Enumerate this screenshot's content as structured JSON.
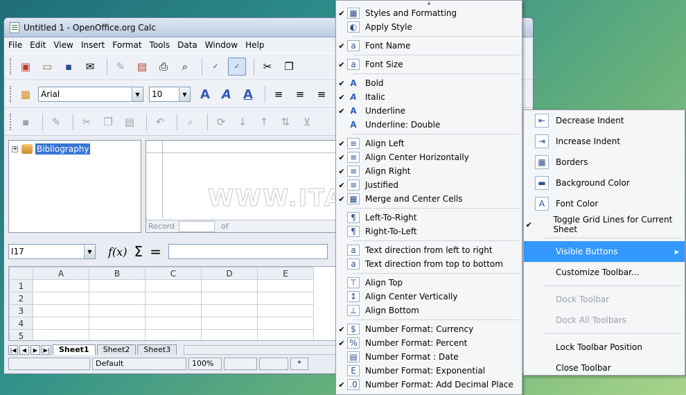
{
  "window": {
    "title": "Untitled 1 - OpenOffice.org Calc"
  },
  "menubar": [
    "File",
    "Edit",
    "View",
    "Insert",
    "Format",
    "Tools",
    "Data",
    "Window",
    "Help"
  ],
  "formatting": {
    "font_name": "Arial",
    "font_size": "10"
  },
  "datasource": {
    "tree_item": "Bibliography",
    "status_record": "Record",
    "status_of": "of"
  },
  "formula_bar": {
    "cell_ref": "I17",
    "fx": "f(x)",
    "sigma": "Σ",
    "equals": "="
  },
  "sheet": {
    "columns": [
      "A",
      "B",
      "C",
      "D",
      "E"
    ],
    "rows": [
      "1",
      "2",
      "3",
      "4",
      "5"
    ],
    "tabs": [
      "Sheet1",
      "Sheet2",
      "Sheet3"
    ]
  },
  "statusbar": {
    "style": "Default",
    "zoom": "100%",
    "mode": "*"
  },
  "watermark": "WWW.ITALIASW.COM",
  "context_menu": {
    "groups": [
      [
        {
          "label": "Styles and Formatting",
          "checked": true,
          "icon": "styles-icon",
          "glyph": "▦"
        },
        {
          "label": "Apply Style",
          "checked": false,
          "icon": "apply-style-icon",
          "glyph": "◐"
        }
      ],
      [
        {
          "label": "Font Name",
          "checked": true,
          "icon": "font-name-icon",
          "glyph": "a"
        }
      ],
      [
        {
          "label": "Font Size",
          "checked": true,
          "icon": "font-size-icon",
          "glyph": "a"
        }
      ],
      [
        {
          "label": "Bold",
          "checked": true,
          "icon": "bold-icon",
          "glyph": "A"
        },
        {
          "label": "Italic",
          "checked": true,
          "icon": "italic-icon",
          "glyph": "A"
        },
        {
          "label": "Underline",
          "checked": true,
          "icon": "underline-icon",
          "glyph": "A"
        },
        {
          "label": "Underline: Double",
          "checked": false,
          "icon": "underline-double-icon",
          "glyph": "A"
        }
      ],
      [
        {
          "label": "Align Left",
          "checked": true,
          "icon": "align-left-icon",
          "glyph": "≡"
        },
        {
          "label": "Align Center Horizontally",
          "checked": true,
          "icon": "align-center-icon",
          "glyph": "≡"
        },
        {
          "label": "Align Right",
          "checked": true,
          "icon": "align-right-icon",
          "glyph": "≡"
        },
        {
          "label": "Justified",
          "checked": true,
          "icon": "justified-icon",
          "glyph": "≡"
        },
        {
          "label": "Merge and Center Cells",
          "checked": true,
          "icon": "merge-cells-icon",
          "glyph": "▦"
        }
      ],
      [
        {
          "label": "Left-To-Right",
          "checked": false,
          "icon": "ltr-icon",
          "glyph": "¶"
        },
        {
          "label": "Right-To-Left",
          "checked": false,
          "icon": "rtl-icon",
          "glyph": "¶"
        }
      ],
      [
        {
          "label": "Text direction from left to right",
          "checked": false,
          "icon": "text-dir-lr-icon",
          "glyph": "a"
        },
        {
          "label": "Text direction from top to bottom",
          "checked": false,
          "icon": "text-dir-tb-icon",
          "glyph": "a"
        }
      ],
      [
        {
          "label": "Align Top",
          "checked": false,
          "icon": "align-top-icon",
          "glyph": "⊤"
        },
        {
          "label": "Align Center Vertically",
          "checked": false,
          "icon": "align-vcenter-icon",
          "glyph": "↕"
        },
        {
          "label": "Align Bottom",
          "checked": false,
          "icon": "align-bottom-icon",
          "glyph": "⊥"
        }
      ],
      [
        {
          "label": "Number Format: Currency",
          "checked": true,
          "icon": "currency-icon",
          "glyph": "$"
        },
        {
          "label": "Number Format: Percent",
          "checked": true,
          "icon": "percent-icon",
          "glyph": "%"
        },
        {
          "label": "Number Format : Date",
          "checked": false,
          "icon": "date-icon",
          "glyph": "▤"
        },
        {
          "label": "Number Format: Exponential",
          "checked": false,
          "icon": "exponential-icon",
          "glyph": "E"
        },
        {
          "label": "Number Format: Add Decimal Place",
          "checked": true,
          "icon": "add-decimal-icon",
          "glyph": ".0"
        }
      ]
    ]
  },
  "sub_menu": {
    "items": [
      {
        "label": "Decrease Indent",
        "icon": "decrease-indent-icon",
        "glyph": "⇤",
        "checked": false,
        "state": "normal"
      },
      {
        "label": "Increase Indent",
        "icon": "increase-indent-icon",
        "glyph": "⇥",
        "checked": false,
        "state": "normal"
      },
      {
        "label": "Borders",
        "icon": "borders-icon",
        "glyph": "▦",
        "checked": false,
        "state": "normal"
      },
      {
        "label": "Background Color",
        "icon": "background-color-icon",
        "glyph": "▬",
        "checked": false,
        "state": "normal"
      },
      {
        "label": "Font Color",
        "icon": "font-color-icon",
        "glyph": "A",
        "checked": false,
        "state": "normal"
      },
      {
        "label": "Toggle Grid Lines for Current Sheet",
        "icon": "",
        "glyph": "",
        "checked": true,
        "state": "normal"
      },
      {
        "sep": true
      },
      {
        "label": "Visible Buttons",
        "icon": "",
        "glyph": "",
        "checked": false,
        "state": "highlight",
        "submenu": true
      },
      {
        "label": "Customize Toolbar...",
        "icon": "",
        "glyph": "",
        "checked": false,
        "state": "normal"
      },
      {
        "sep": true
      },
      {
        "label": "Dock Toolbar",
        "icon": "",
        "glyph": "",
        "checked": false,
        "state": "disabled"
      },
      {
        "label": "Dock All Toolbars",
        "icon": "",
        "glyph": "",
        "checked": false,
        "state": "disabled"
      },
      {
        "sep": true
      },
      {
        "label": "Lock Toolbar Position",
        "icon": "",
        "glyph": "",
        "checked": false,
        "state": "normal"
      },
      {
        "label": "Close Toolbar",
        "icon": "",
        "glyph": "",
        "checked": false,
        "state": "normal"
      }
    ]
  }
}
